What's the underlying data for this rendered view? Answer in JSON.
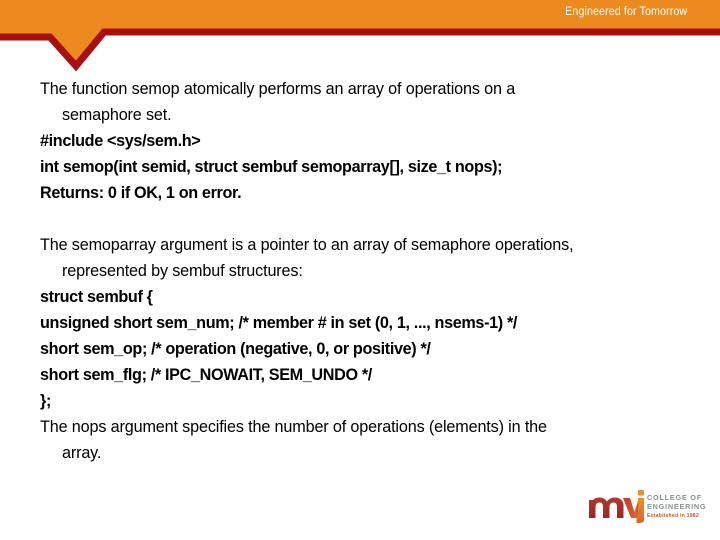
{
  "header": {
    "tagline": "Engineered for Tomorrow",
    "orange_color": "#EC8A20",
    "red_color": "#A81010"
  },
  "content": {
    "paragraph_1": [
      {
        "text": "The function semop atomically performs an array of operations on a",
        "bold": false,
        "indent": false
      },
      {
        "text": "semaphore set.",
        "bold": false,
        "indent": true
      },
      {
        "text": "#include <sys/sem.h>",
        "bold": true,
        "indent": false
      },
      {
        "text": "int semop(int semid, struct sembuf semoparray[], size_t nops);",
        "bold": true,
        "indent": false
      },
      {
        "text": "Returns: 0 if OK, 1 on error.",
        "bold": true,
        "indent": false
      }
    ],
    "paragraph_2": [
      {
        "text": "The semoparray argument is a pointer to an array of semaphore operations,",
        "bold": false,
        "indent": false
      },
      {
        "text": "represented by sembuf structures:",
        "bold": false,
        "indent": true
      },
      {
        "text": "struct sembuf {",
        "bold": true,
        "indent": false
      },
      {
        "text": "unsigned short sem_num; /* member # in set (0, 1, ..., nsems-1) */",
        "bold": true,
        "indent": false
      },
      {
        "text": "short sem_op; /* operation (negative, 0, or positive) */",
        "bold": true,
        "indent": false
      },
      {
        "text": "short sem_flg; /* IPC_NOWAIT, SEM_UNDO */",
        "bold": true,
        "indent": false
      },
      {
        "text": "};",
        "bold": true,
        "indent": false
      },
      {
        "text": "The nops argument specifies the number of operations (elements) in the",
        "bold": false,
        "indent": false
      },
      {
        "text": "array.",
        "bold": false,
        "indent": true
      }
    ]
  },
  "logo": {
    "wordmark": "mvj",
    "line1": "COLLEGE OF",
    "line2": "ENGINEERING",
    "line3": "Established in 1982",
    "color_m": "#A42E2B",
    "color_v": "#D1462E",
    "color_j": "#E98A2B",
    "text_color": "#8a8f93",
    "accent_color": "#b9602f"
  }
}
